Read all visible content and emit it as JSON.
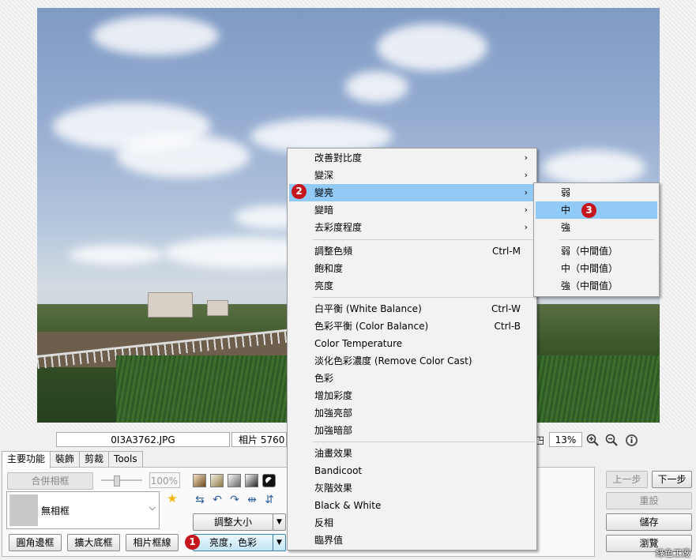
{
  "info": {
    "filename": "0I3A3762.JPG",
    "photo_size": "相片 5760",
    "zoom": "13%"
  },
  "tabs": [
    {
      "label": "主要功能"
    },
    {
      "label": "裝飾"
    },
    {
      "label": "剪裁"
    },
    {
      "label": "Tools"
    }
  ],
  "panel": {
    "merge_frame": "合併相框",
    "opacity_value": "100%",
    "frame_select": "無相框",
    "round_border": "圓角邊框",
    "expand_bottom": "擴大底框",
    "photo_frame_line": "相片框線",
    "resize": "調整大小",
    "brightness_color": "亮度，色彩"
  },
  "right_buttons": {
    "prev": "上一步",
    "next": "下一步",
    "reset": "重設",
    "save": "儲存",
    "browse": "瀏覽"
  },
  "menu": {
    "items": [
      {
        "label": "改善對比度",
        "arrow": "›"
      },
      {
        "label": "變深",
        "arrow": "›"
      },
      {
        "label": "變亮",
        "arrow": "›"
      },
      {
        "label": "變暗",
        "arrow": "›"
      },
      {
        "label": "去彩度程度",
        "arrow": "›"
      },
      {
        "label": "調整色頻",
        "shortcut": "Ctrl-M"
      },
      {
        "label": "飽和度"
      },
      {
        "label": "亮度"
      },
      {
        "label": "白平衡 (White Balance)",
        "shortcut": "Ctrl-W"
      },
      {
        "label": "色彩平衡 (Color Balance)",
        "shortcut": "Ctrl-B"
      },
      {
        "label": "Color Temperature"
      },
      {
        "label": "淡化色彩濃度 (Remove Color Cast)"
      },
      {
        "label": "色彩"
      },
      {
        "label": "增加彩度"
      },
      {
        "label": "加強亮部"
      },
      {
        "label": "加強暗部"
      },
      {
        "label": "油畫效果"
      },
      {
        "label": "Bandicoot"
      },
      {
        "label": "灰階效果"
      },
      {
        "label": "Black & White"
      },
      {
        "label": "反相"
      },
      {
        "label": "臨界值"
      }
    ]
  },
  "submenu": {
    "items": [
      {
        "label": "弱"
      },
      {
        "label": "中"
      },
      {
        "label": "強"
      },
      {
        "label": "弱（中間值）"
      },
      {
        "label": "中（中間值）"
      },
      {
        "label": "強（中間值）"
      }
    ]
  },
  "badges": [
    "1",
    "2",
    "3"
  ],
  "watermark": "綠色工廠",
  "colors": {
    "highlight": "#91c9f7",
    "badge": "#c4161c"
  }
}
